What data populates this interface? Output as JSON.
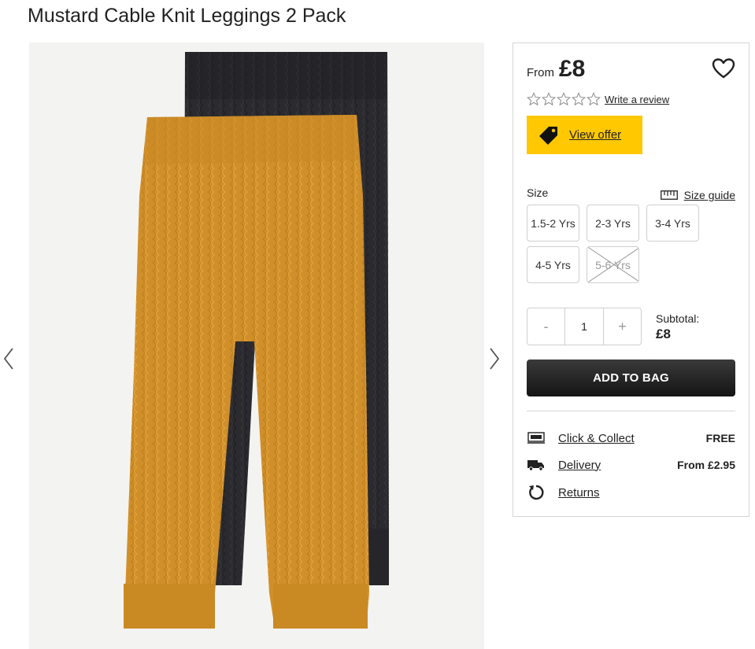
{
  "product": {
    "title": "Mustard Cable Knit Leggings 2 Pack"
  },
  "gallery": {
    "image_alt": "Mustard and navy cable knit leggings"
  },
  "price": {
    "prefix": "From",
    "value": "£8"
  },
  "rating": {
    "stars_filled": 0,
    "stars_total": 5,
    "review_link": "Write a review"
  },
  "offer": {
    "label": "View offer",
    "color": "#ffc800"
  },
  "size": {
    "label": "Size",
    "guide_label": "Size guide",
    "options": [
      {
        "label": "1.5-2 Yrs",
        "available": true
      },
      {
        "label": "2-3 Yrs",
        "available": true
      },
      {
        "label": "3-4 Yrs",
        "available": true
      },
      {
        "label": "4-5 Yrs",
        "available": true
      },
      {
        "label": "5-6 Yrs",
        "available": false
      }
    ]
  },
  "quantity": {
    "minus": "-",
    "value": "1",
    "plus": "+"
  },
  "subtotal": {
    "label": "Subtotal:",
    "value": "£8"
  },
  "add_to_bag": {
    "label": "ADD TO BAG"
  },
  "services": [
    {
      "icon": "click-collect-icon",
      "label": "Click & Collect",
      "value": "FREE"
    },
    {
      "icon": "delivery-truck-icon",
      "label": "Delivery",
      "value": "From £2.95"
    },
    {
      "icon": "returns-icon",
      "label": "Returns",
      "value": ""
    }
  ]
}
